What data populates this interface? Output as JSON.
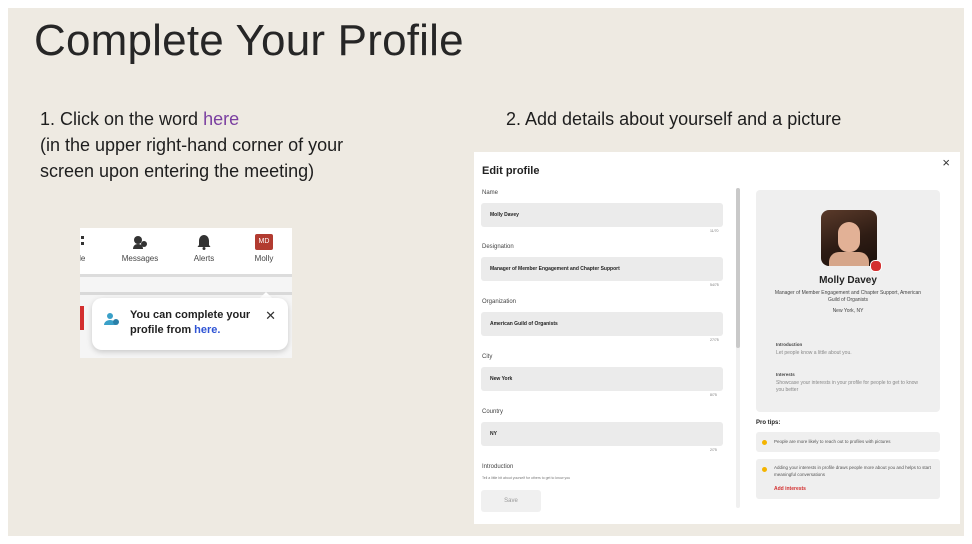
{
  "slide": {
    "title": "Complete Your Profile",
    "step1_pre": "1.  Click on the word ",
    "step1_link": "here",
    "step1_post": "(in the upper right-hand corner of your screen upon entering the meeting)",
    "step2": "2.  Add details about yourself and a picture"
  },
  "navbar": {
    "items": [
      {
        "label": "ole",
        "icon": "partial-icon"
      },
      {
        "label": "Messages",
        "icon": "messages-icon"
      },
      {
        "label": "Alerts",
        "icon": "bell-icon"
      },
      {
        "label": "Molly",
        "icon": "avatar",
        "avatar_text": "MD"
      }
    ]
  },
  "tooltip": {
    "text": "You can complete your profile from ",
    "link": "here.",
    "close": "✕"
  },
  "edit_profile": {
    "title": "Edit profile",
    "close": "×",
    "fields": [
      {
        "label": "Name",
        "value": "Molly Davey",
        "count": "11/70"
      },
      {
        "label": "Designation",
        "value": "Manager of Member Engagement and Chapter Support",
        "count": "54/75"
      },
      {
        "label": "Organization",
        "value": "American Guild of Organists",
        "count": "27/75"
      },
      {
        "label": "City",
        "value": "New York",
        "count": "8/75"
      },
      {
        "label": "Country",
        "value": "NY",
        "count": "2/75"
      }
    ],
    "intro_label": "Introduction",
    "intro_hint": "Tell a little bit about yourself for others to get to know you",
    "save_label": "Save"
  },
  "profile_card": {
    "name": "Molly Davey",
    "designation": "Manager of Member Engagement and Chapter Support, American Guild of Organists",
    "location": "New York, NY",
    "intro_heading": "Introduction",
    "intro_text": "Let people know a little about you.",
    "interests_heading": "Interests",
    "interests_text": "Showcase your interests in your profile for people to get to know you better"
  },
  "pro_tips": {
    "heading": "Pro tips:",
    "tip1": "People are more likely to reach out to profiles with pictures",
    "tip2": "Adding your interests in profile draws people more about you and helps to start meaningful conversations",
    "tip2_link": "Add interests"
  },
  "colors": {
    "accent_red": "#d32f2f",
    "link_purple": "#7a3fa0",
    "link_blue": "#2f54d4"
  }
}
